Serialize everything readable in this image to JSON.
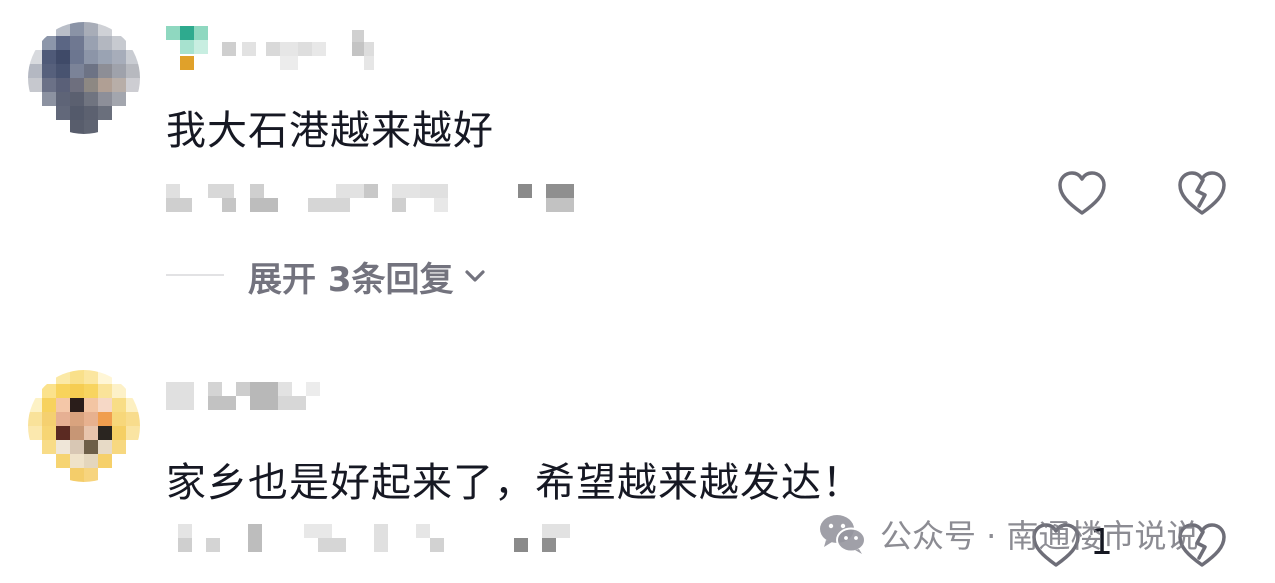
{
  "comments": [
    {
      "text": "我大石港越来越好",
      "expand_replies_label": "展开 3条回复",
      "like_icon": "heart-icon",
      "dislike_icon": "broken-heart-icon"
    },
    {
      "text": "家乡也是好起来了，希望越来越发达！",
      "like_count": "1",
      "like_icon": "heart-icon",
      "dislike_icon": "broken-heart-icon"
    }
  ],
  "watermark": {
    "text": "公众号 · 南通楼市说说",
    "icon": "wechat-icon"
  },
  "colors": {
    "text_primary": "#161823",
    "text_secondary": "#73737e",
    "icon_stroke": "#6e6e78",
    "divider": "#e2e2e4"
  }
}
